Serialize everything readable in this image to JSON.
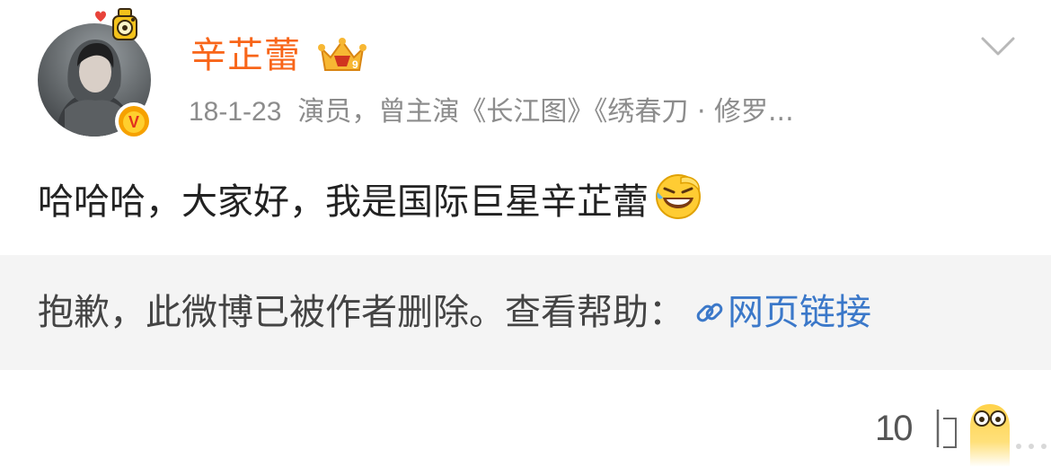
{
  "post": {
    "username": "辛芷蕾",
    "date": "18-1-23",
    "description": "演员，曾主演《长江图》《绣春刀 · 修罗...",
    "content": "哈哈哈，大家好，我是国际巨星辛芷蕾",
    "verified_badge": "V"
  },
  "deleted_notice": {
    "text": "抱歉，此微博已被作者删除。查看帮助：",
    "link_label": "网页链接"
  },
  "footer": {
    "count": "10"
  },
  "colors": {
    "username": "#f86519",
    "link": "#3b78c9",
    "meta": "#8c8c8c",
    "deleted_bg": "#f4f4f4"
  },
  "icons": [
    "avatar-pendant-icon",
    "crown-vip-icon",
    "chevron-down-icon",
    "laugh-cry-emoji-icon",
    "link-icon",
    "thumbs-up-icon",
    "shocked-emoji-icon"
  ]
}
